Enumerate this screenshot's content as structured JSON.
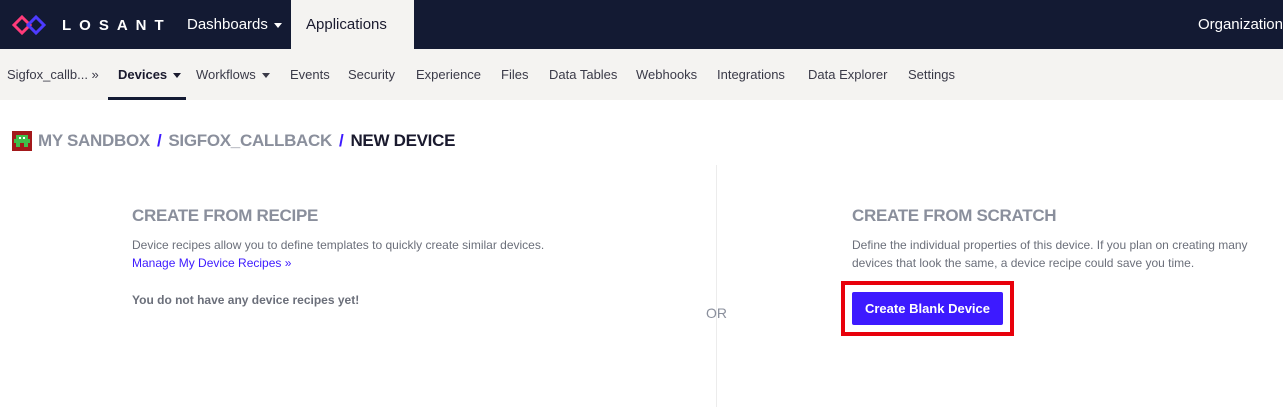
{
  "topbar": {
    "logo_text": "LOSANT",
    "nav": [
      {
        "label": "Dashboards"
      },
      {
        "label": "Applications"
      }
    ],
    "organization_label": "Organization"
  },
  "subnav": {
    "items": [
      {
        "label": "Sigfox_callb... »"
      },
      {
        "label": "Devices"
      },
      {
        "label": "Workflows"
      },
      {
        "label": "Events"
      },
      {
        "label": "Security"
      },
      {
        "label": "Experience"
      },
      {
        "label": "Files"
      },
      {
        "label": "Data Tables"
      },
      {
        "label": "Webhooks"
      },
      {
        "label": "Integrations"
      },
      {
        "label": "Data Explorer"
      },
      {
        "label": "Settings"
      }
    ]
  },
  "breadcrumb": {
    "items": [
      "MY SANDBOX",
      "SIGFOX_CALLBACK",
      "NEW DEVICE"
    ],
    "separator": "/"
  },
  "recipe_section": {
    "title": "CREATE FROM RECIPE",
    "description": "Device recipes allow you to define templates to quickly create similar devices.",
    "manage_link": "Manage My Device Recipes »",
    "empty_message": "You do not have any device recipes yet!"
  },
  "or_label": "OR",
  "scratch_section": {
    "title": "CREATE FROM SCRATCH",
    "description_line1": "Define the individual properties of this device. If you plan on creating many",
    "description_line2": "devices that look the same, a device recipe could save you time.",
    "button_label": "Create Blank Device"
  },
  "colors": {
    "topbar_bg": "#131a33",
    "subbar_bg": "#f4f3f1",
    "accent": "#3d1aff",
    "highlight": "#e8000b"
  }
}
